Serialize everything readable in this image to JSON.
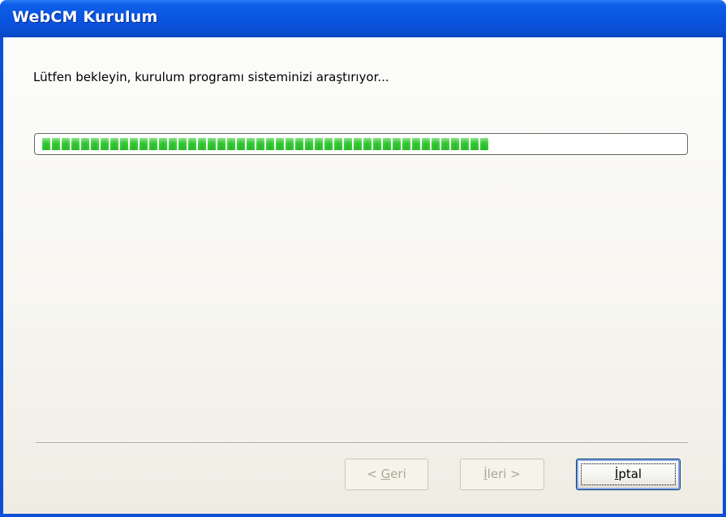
{
  "window": {
    "title": "WebCM Kurulum"
  },
  "main": {
    "message": "Lütfen bekleyin, kurulum programı sisteminizi araştırıyor...",
    "progress_fraction": 0.71,
    "progress_color": "#3ad33a"
  },
  "buttons": {
    "back": {
      "label_prefix": "< ",
      "label_accel": "G",
      "label_rest": "eri"
    },
    "next": {
      "label_accel": "İ",
      "label_rest": "leri >"
    },
    "cancel": {
      "label_accel": "İ",
      "label_mid": "p",
      "label_rest": "tal"
    }
  }
}
